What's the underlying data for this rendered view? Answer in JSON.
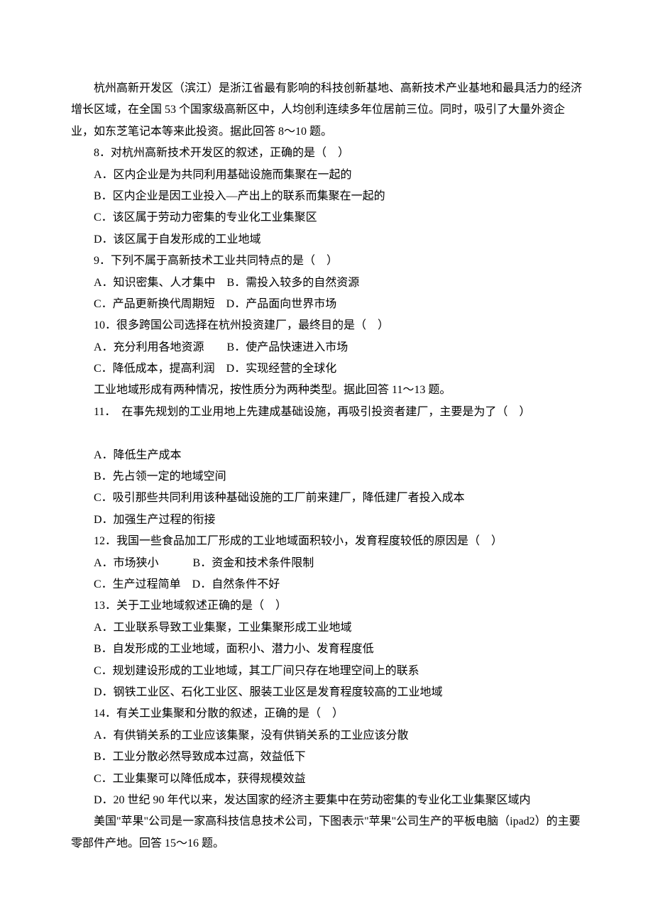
{
  "intro1": "杭州高新开发区（滨江）是浙江省最有影响的科技创新基地、高新技术产业基地和最具活力的经济增长区域，在全国 53 个国家级高新区中，人均创利连续多年位居前三位。同时，吸引了大量外资企业，如东芝笔记本等来此投资。据此回答 8～10 题。",
  "q8": {
    "stem": "8．对杭州高新技术开发区的叙述，正确的是（　）",
    "a": "A．区内企业是为共同利用基础设施而集聚在一起的",
    "b": "B．区内企业是因工业投入—产出上的联系而集聚在一起的",
    "c": "C．该区属于劳动力密集的专业化工业集聚区",
    "d": "D．该区属于自发形成的工业地域"
  },
  "q9": {
    "stem": "9．下列不属于高新技术工业共同特点的是（　）",
    "ab": "A．知识密集、人才集中　B．需投入较多的自然资源",
    "cd": "C．产品更新换代周期短　D．产品面向世界市场"
  },
  "q10": {
    "stem": "10．很多跨国公司选择在杭州投资建厂，最终目的是（　）",
    "ab": "A．充分利用各地资源　　B．使产品快速进入市场",
    "cd": "C．降低成本，提高利润　D．实现经营的全球化"
  },
  "intro2": "工业地域形成有两种情况，按性质分为两种类型。据此回答 11～13 题。",
  "q11": {
    "stem": "11．　在事先规划的工业用地上先建成基础设施，再吸引投资者建厂，主要是为了（　）",
    "a": "A．降低生产成本",
    "b": "B．先占领一定的地域空间",
    "c": "C．吸引那些共同利用该种基础设施的工厂前来建厂，降低建厂者投入成本",
    "d": "D．加强生产过程的衔接"
  },
  "q12": {
    "stem": "12．我国一些食品加工厂形成的工业地域面积较小，发育程度较低的原因是（　）",
    "ab": "A．市场狭小　　　B．资金和技术条件限制",
    "cd": "C．生产过程简单　D．自然条件不好"
  },
  "q13": {
    "stem": "13．关于工业地域叙述正确的是（　）",
    "a": "A．工业联系导致工业集聚，工业集聚形成工业地域",
    "b": "B．自发形成的工业地域，面积小、潜力小、发育程度低",
    "c": "C．规划建设形成的工业地域，其工厂间只存在地理空间上的联系",
    "d": "D．钢铁工业区、石化工业区、服装工业区是发育程度较高的工业地域"
  },
  "q14": {
    "stem": "14．有关工业集聚和分散的叙述，正确的是（　）",
    "a": "A．有供销关系的工业应该集聚，没有供销关系的工业应该分散",
    "b": "B．工业分散必然导致成本过高，效益低下",
    "c": "C．工业集聚可以降低成本，获得规模效益",
    "d": "D．20 世纪 90 年代以来，发达国家的经济主要集中在劳动密集的专业化工业集聚区域内"
  },
  "intro3": "美国\"苹果\"公司是一家高科技信息技术公司，下图表示\"苹果\"公司生产的平板电脑（ipad2）的主要零部件产地。回答 15～16 题。"
}
